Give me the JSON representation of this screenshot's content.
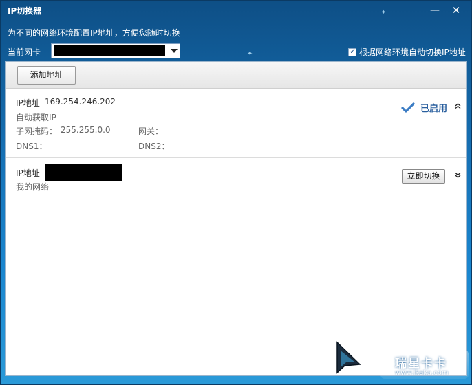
{
  "window": {
    "title": "IP切换器",
    "minimize_symbol": "—",
    "close_symbol": "✕"
  },
  "header": {
    "subtitle": "为不同的网络环境配置IP地址，方便您随时切换",
    "current_nic_label": "当前网卡",
    "current_nic_value": "",
    "auto_switch_label": "根据网络环境自动切换IP地址",
    "auto_switch_checked": true
  },
  "toolbar": {
    "add_button_label": "添加地址"
  },
  "entries": [
    {
      "ip_label": "IP地址",
      "ip_value": "169.254.246.202",
      "desc": "自动获取IP",
      "subnet_label": "子网掩码：",
      "subnet_value": "255.255.0.0",
      "gateway_label": "网关：",
      "gateway_value": "",
      "dns1_label": "DNS1：",
      "dns1_value": "",
      "dns2_label": "DNS2：",
      "dns2_value": "",
      "status_label": "已启用",
      "toggle_icon": "chevron-up"
    },
    {
      "ip_label": "IP地址",
      "ip_value": "",
      "desc": "我的网络",
      "action_label": "立即切换",
      "toggle_icon": "chevron-down"
    }
  ],
  "watermark": {
    "main": "瑞星卡卡",
    "url": "www.ikaka.com"
  },
  "colors": {
    "frame_top": "#0e4f86",
    "frame_bottom": "#2b9ad8",
    "status_text": "#2a5f9e"
  }
}
